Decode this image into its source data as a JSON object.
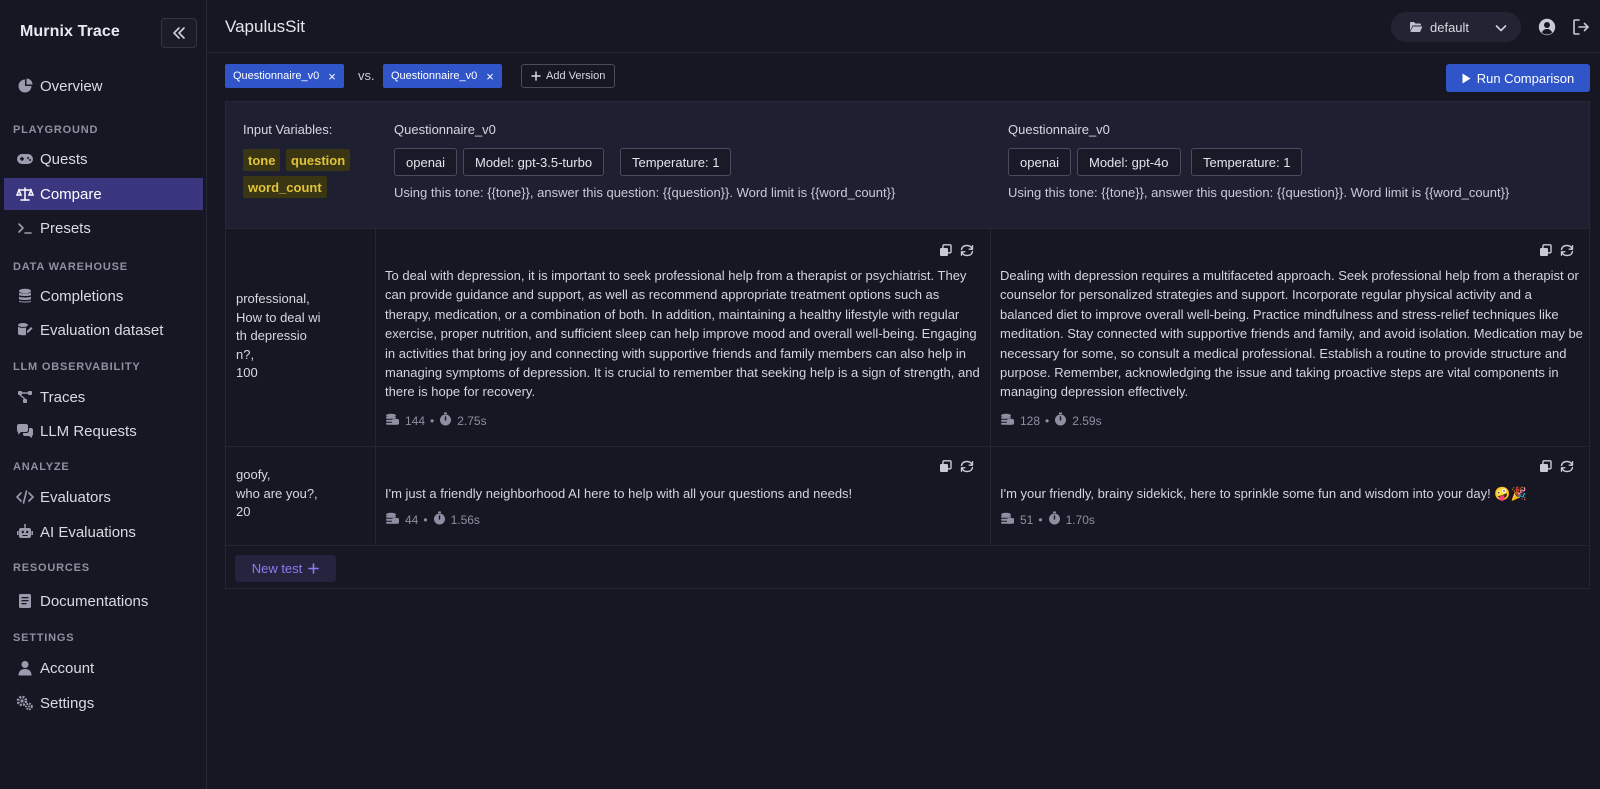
{
  "sidebar": {
    "brand": "Murnix Trace",
    "overview": "Overview",
    "sections": {
      "playground": "PLAYGROUND",
      "data_warehouse": "DATA WAREHOUSE",
      "llm_observability": "LLM OBSERVABILITY",
      "analyze": "ANALYZE",
      "resources": "RESOURCES",
      "settings": "SETTINGS"
    },
    "items": {
      "quests": "Quests",
      "compare": "Compare",
      "presets": "Presets",
      "completions": "Completions",
      "evaluation_dataset": "Evaluation dataset",
      "traces": "Traces",
      "llm_requests": "LLM Requests",
      "evaluators": "Evaluators",
      "ai_evaluations": "AI Evaluations",
      "documentations": "Documentations",
      "account": "Account",
      "settings": "Settings"
    },
    "active_item": "Compare"
  },
  "header": {
    "title": "VapulusSit",
    "project": "default"
  },
  "toolbar": {
    "versions": [
      "Questionnaire_v0",
      "Questionnaire_v0"
    ],
    "remove_symbol": "×",
    "vs_label": "vs.",
    "add_version_label": "Add Version",
    "run_label": "Run Comparison"
  },
  "config": {
    "input_variables_label": "Input Variables:",
    "variables": [
      "tone",
      "question",
      "word_count"
    ],
    "columns": [
      {
        "title": "Questionnaire_v0",
        "provider": "openai",
        "model": "Model: gpt-3.5-turbo",
        "temperature": "Temperature: 1",
        "template": "Using this tone: {{tone}}, answer this question: {{question}}. Word limit is {{word_count}}"
      },
      {
        "title": "Questionnaire_v0",
        "provider": "openai",
        "model": "Model: gpt-4o",
        "temperature": "Temperature: 1",
        "template": "Using this tone: {{tone}}, answer this question: {{question}}. Word limit is {{word_count}}"
      }
    ]
  },
  "tests": [
    {
      "inputs": "professional,\nHow to deal wi\nth depressio\nn?,\n100",
      "results": [
        {
          "text": "To deal with depression, it is important to seek professional help from a therapist or psychiatrist. They can provide guidance and support, as well as recommend appropriate treatment options such as therapy, medication, or a combination of both. In addition, maintaining a healthy lifestyle with regular exercise, proper nutrition, and sufficient sleep can help improve mood and overall well-being. Engaging in activities that bring joy and connecting with supportive friends and family members can also help in managing symptoms of depression. It is crucial to remember that seeking help is a sign of strength, and there is hope for recovery.",
          "tokens": "144",
          "duration": "2.75s"
        },
        {
          "text": "Dealing with depression requires a multifaceted approach. Seek professional help from a therapist or counselor for personalized strategies and support. Incorporate regular physical activity and a balanced diet to improve overall well-being. Practice mindfulness and stress-relief techniques like meditation. Stay connected with supportive friends and family, and avoid isolation. Medication may be necessary for some, so consult a medical professional. Establish a routine to provide structure and purpose. Remember, acknowledging the issue and taking proactive steps are vital components in managing depression effectively.",
          "tokens": "128",
          "duration": "2.59s"
        }
      ]
    },
    {
      "inputs": "goofy,\nwho are you?,\n20",
      "results": [
        {
          "text": "I'm just a friendly neighborhood AI here to help with all your questions and needs!",
          "tokens": "44",
          "duration": "1.56s"
        },
        {
          "text": "I'm your friendly, brainy sidekick, here to sprinkle some fun and wisdom into your day! 🤪🎉",
          "tokens": "51",
          "duration": "1.70s"
        }
      ]
    }
  ],
  "meta_separator": "•",
  "new_test_label": "New test",
  "colors": {
    "accent": "#2f55c8",
    "active_nav": "#3b3680",
    "variable_tag_bg": "#3a3512",
    "variable_tag_text": "#e2c43a",
    "new_test_text": "#8b7cf0"
  }
}
